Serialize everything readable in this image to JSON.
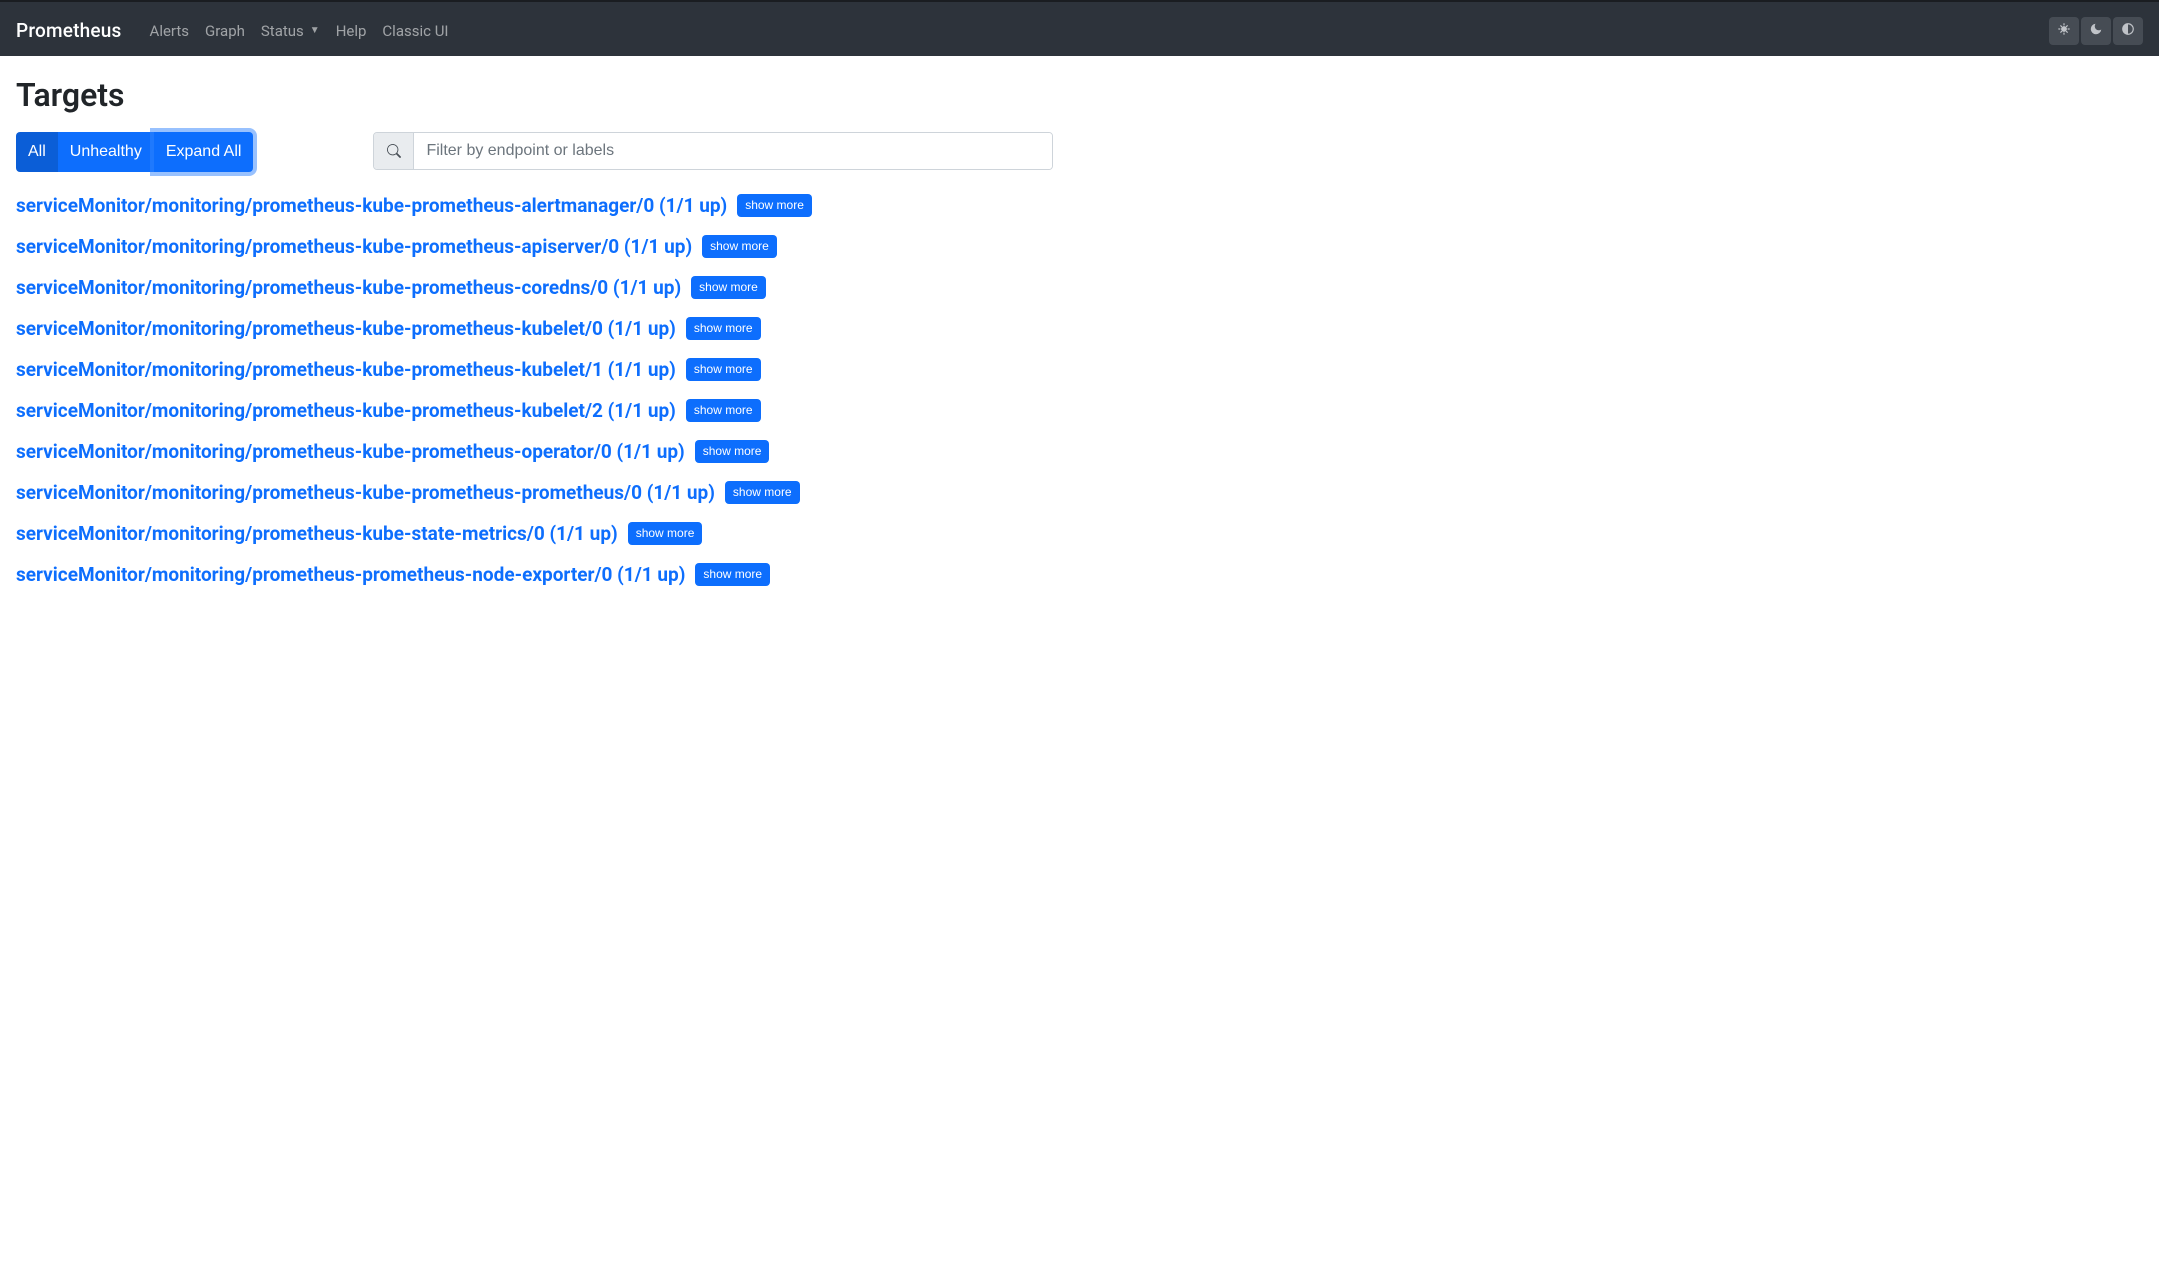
{
  "navbar": {
    "brand": "Prometheus",
    "links": {
      "alerts": "Alerts",
      "graph": "Graph",
      "status": "Status",
      "help": "Help",
      "classic": "Classic UI"
    }
  },
  "page": {
    "title": "Targets"
  },
  "controls": {
    "tab_all": "All",
    "tab_unhealthy": "Unhealthy",
    "expand_all": "Expand All"
  },
  "search": {
    "placeholder": "Filter by endpoint or labels"
  },
  "show_more_label": "show more",
  "groups": [
    {
      "label": "serviceMonitor/monitoring/prometheus-kube-prometheus-alertmanager/0 (1/1 up)"
    },
    {
      "label": "serviceMonitor/monitoring/prometheus-kube-prometheus-apiserver/0 (1/1 up)"
    },
    {
      "label": "serviceMonitor/monitoring/prometheus-kube-prometheus-coredns/0 (1/1 up)"
    },
    {
      "label": "serviceMonitor/monitoring/prometheus-kube-prometheus-kubelet/0 (1/1 up)"
    },
    {
      "label": "serviceMonitor/monitoring/prometheus-kube-prometheus-kubelet/1 (1/1 up)"
    },
    {
      "label": "serviceMonitor/monitoring/prometheus-kube-prometheus-kubelet/2 (1/1 up)"
    },
    {
      "label": "serviceMonitor/monitoring/prometheus-kube-prometheus-operator/0 (1/1 up)"
    },
    {
      "label": "serviceMonitor/monitoring/prometheus-kube-prometheus-prometheus/0 (1/1 up)"
    },
    {
      "label": "serviceMonitor/monitoring/prometheus-kube-state-metrics/0 (1/1 up)"
    },
    {
      "label": "serviceMonitor/monitoring/prometheus-prometheus-node-exporter/0 (1/1 up)"
    }
  ]
}
